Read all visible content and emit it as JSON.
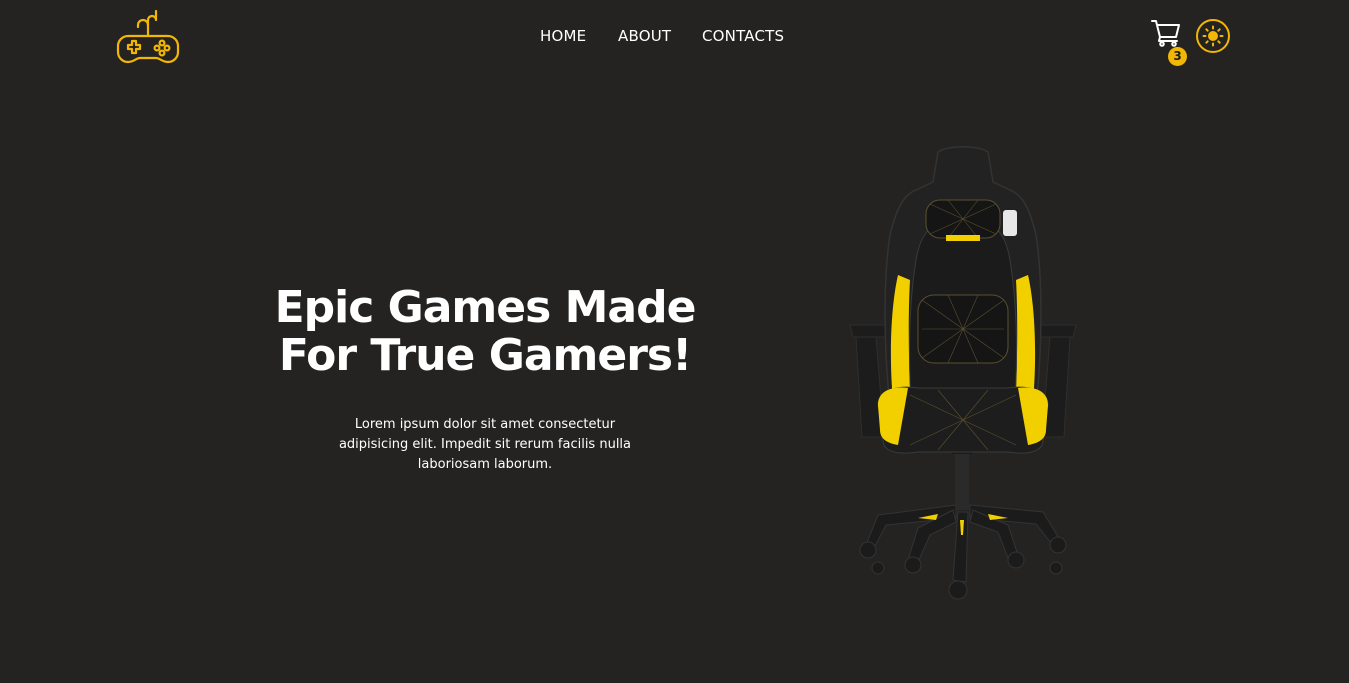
{
  "header": {
    "logo_icon": "gamepad-icon",
    "nav": [
      {
        "label": "HOME"
      },
      {
        "label": "ABOUT"
      },
      {
        "label": "CONTACTS"
      }
    ],
    "cart_icon": "cart-icon",
    "cart_count": "3",
    "theme_icon": "sun-icon"
  },
  "hero": {
    "title_line1": "Epic Games Made",
    "title_line2": "For True Gamers!",
    "description": "Lorem ipsum dolor sit amet consectetur adipisicing elit. Impedit sit rerum facilis nulla laboriosam laborum.",
    "image": "gaming-chair"
  },
  "colors": {
    "background": "#242322",
    "accent": "#f2b705",
    "text": "#ffffff"
  }
}
